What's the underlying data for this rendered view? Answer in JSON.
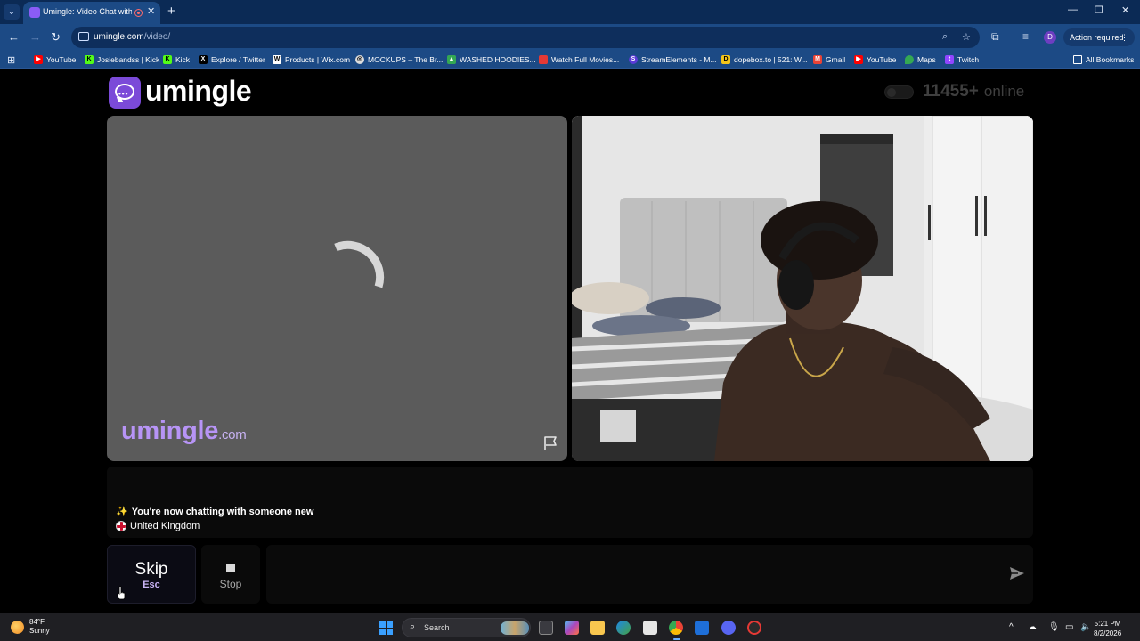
{
  "browser": {
    "tab_title": "Umingle: Video Chat with S",
    "url_host": "umingle.com",
    "url_path": "/video/",
    "action_required": "Action required",
    "profile_initial": "D",
    "bookmarks": [
      {
        "label": "YouTube",
        "icon": "youtube-icon",
        "color": "#ff0000"
      },
      {
        "label": "Josiebandss | Kick",
        "icon": "kick-icon",
        "color": "#53fc18"
      },
      {
        "label": "Kick",
        "icon": "kick-icon",
        "color": "#53fc18"
      },
      {
        "label": "Explore / Twitter",
        "icon": "x-icon",
        "color": "#000000"
      },
      {
        "label": "Products | Wix.com",
        "icon": "wix-icon",
        "color": "#ffffff"
      },
      {
        "label": "MOCKUPS – The Br...",
        "icon": "globe-icon",
        "color": "#dddddd"
      },
      {
        "label": "WASHED HOODIES...",
        "icon": "drive-icon",
        "color": "#34a853"
      },
      {
        "label": "Watch Full Movies...",
        "icon": "movie-icon",
        "color": "#e53935"
      },
      {
        "label": "StreamElements - M...",
        "icon": "streamelements-icon",
        "color": "#5b3bd6"
      },
      {
        "label": "dopebox.to | 521: W...",
        "icon": "dopebox-icon",
        "color": "#f5c518"
      },
      {
        "label": "Gmail",
        "icon": "gmail-icon",
        "color": "#ea4335"
      },
      {
        "label": "YouTube",
        "icon": "youtube-icon",
        "color": "#ff0000"
      },
      {
        "label": "Maps",
        "icon": "maps-icon",
        "color": "#34a853"
      },
      {
        "label": "Twitch",
        "icon": "twitch-icon",
        "color": "#9146ff"
      }
    ],
    "all_bookmarks": "All Bookmarks"
  },
  "site": {
    "brand": "umingle",
    "online_count": "11455+",
    "online_label": "online",
    "watermark_main": "umingle",
    "watermark_suffix": ".com",
    "accent": "#7b4ad8"
  },
  "chat": {
    "status_message": "You're now chatting with someone new",
    "country": "United Kingdom",
    "input_placeholder": ""
  },
  "controls": {
    "skip_label": "Skip",
    "skip_key": "Esc",
    "stop_label": "Stop"
  },
  "taskbar": {
    "temperature": "84°F",
    "condition": "Sunny",
    "search_placeholder": "Search",
    "time": "5:21 PM",
    "date": "8/2/2026"
  }
}
